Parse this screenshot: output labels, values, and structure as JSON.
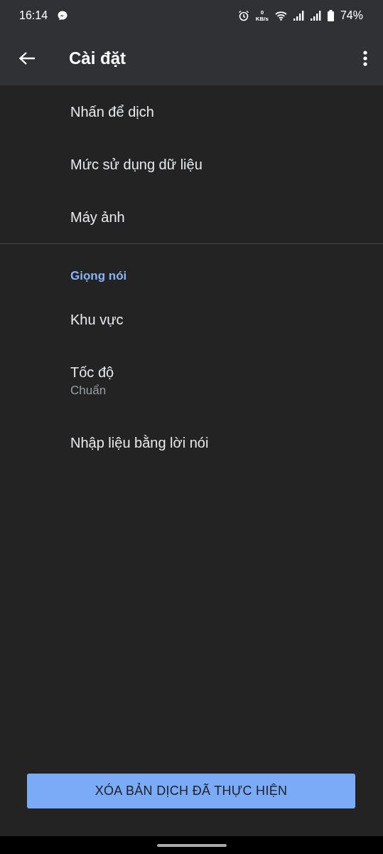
{
  "status_bar": {
    "time": "16:14",
    "net_speed": "0",
    "net_unit": "KB/s",
    "battery": "74%"
  },
  "app_bar": {
    "title": "Cài đặt"
  },
  "sections": [
    {
      "items": [
        {
          "title": "Nhấn để dịch"
        },
        {
          "title": "Mức sử dụng dữ liệu"
        },
        {
          "title": "Máy ảnh"
        }
      ]
    },
    {
      "header": "Giọng nói",
      "items": [
        {
          "title": "Khu vực"
        },
        {
          "title": "Tốc độ",
          "subtitle": "Chuẩn"
        },
        {
          "title": "Nhập liệu bằng lời nói"
        }
      ]
    }
  ],
  "button": {
    "label": "XÓA BẢN DỊCH ĐÃ THỰC HIỆN"
  }
}
